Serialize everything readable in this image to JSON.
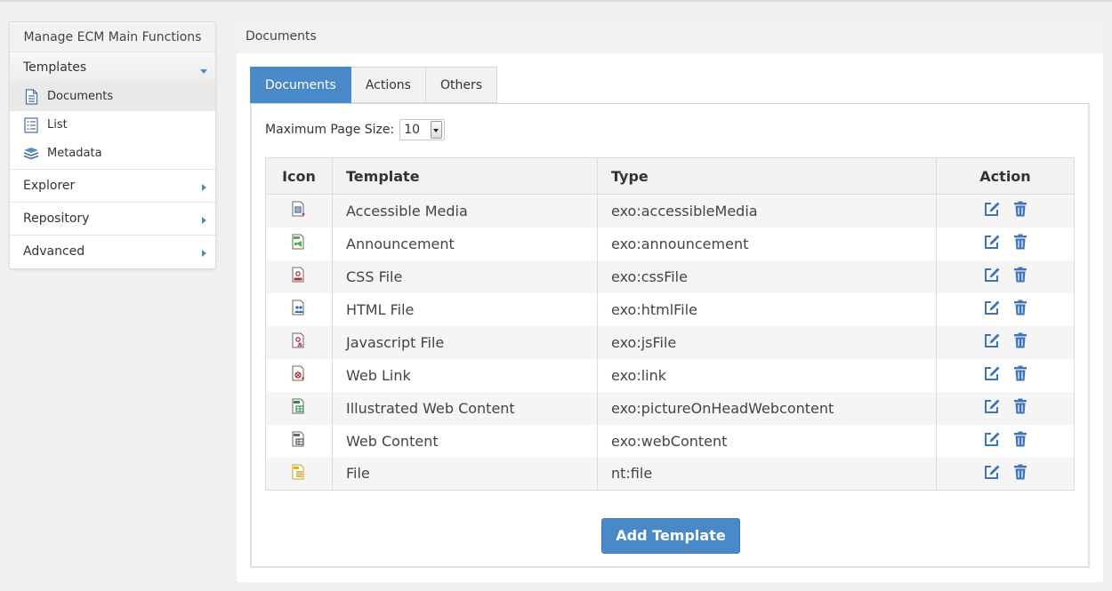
{
  "sidebar": {
    "title": "Manage ECM Main Functions",
    "sections": [
      {
        "label": "Templates",
        "expanded": true
      },
      {
        "label": "Explorer",
        "expanded": false
      },
      {
        "label": "Repository",
        "expanded": false
      },
      {
        "label": "Advanced",
        "expanded": false
      }
    ],
    "template_items": [
      {
        "label": "Documents",
        "icon": "document-icon",
        "active": true
      },
      {
        "label": "List",
        "icon": "list-icon",
        "active": false
      },
      {
        "label": "Metadata",
        "icon": "metadata-icon",
        "active": false
      }
    ]
  },
  "main": {
    "header": "Documents",
    "tabs": [
      {
        "label": "Documents",
        "active": true
      },
      {
        "label": "Actions",
        "active": false
      },
      {
        "label": "Others",
        "active": false
      }
    ],
    "page_size": {
      "label": "Maximum Page Size:",
      "value": "10"
    },
    "table": {
      "headers": [
        "Icon",
        "Template",
        "Type",
        "Action"
      ],
      "rows": [
        {
          "template": "Accessible Media",
          "type": "exo:accessibleMedia",
          "icon": "accessible-media-icon"
        },
        {
          "template": "Announcement",
          "type": "exo:announcement",
          "icon": "announcement-icon"
        },
        {
          "template": "CSS File",
          "type": "exo:cssFile",
          "icon": "css-file-icon"
        },
        {
          "template": "HTML File",
          "type": "exo:htmlFile",
          "icon": "html-file-icon"
        },
        {
          "template": "Javascript File",
          "type": "exo:jsFile",
          "icon": "javascript-file-icon"
        },
        {
          "template": "Web Link",
          "type": "exo:link",
          "icon": "web-link-icon"
        },
        {
          "template": "Illustrated Web Content",
          "type": "exo:pictureOnHeadWebcontent",
          "icon": "illustrated-web-content-icon"
        },
        {
          "template": "Web Content",
          "type": "exo:webContent",
          "icon": "web-content-icon"
        },
        {
          "template": "File",
          "type": "nt:file",
          "icon": "file-icon"
        }
      ]
    },
    "add_button": "Add Template"
  },
  "colors": {
    "accent": "#4a89c8",
    "background": "#f0f0f0"
  }
}
